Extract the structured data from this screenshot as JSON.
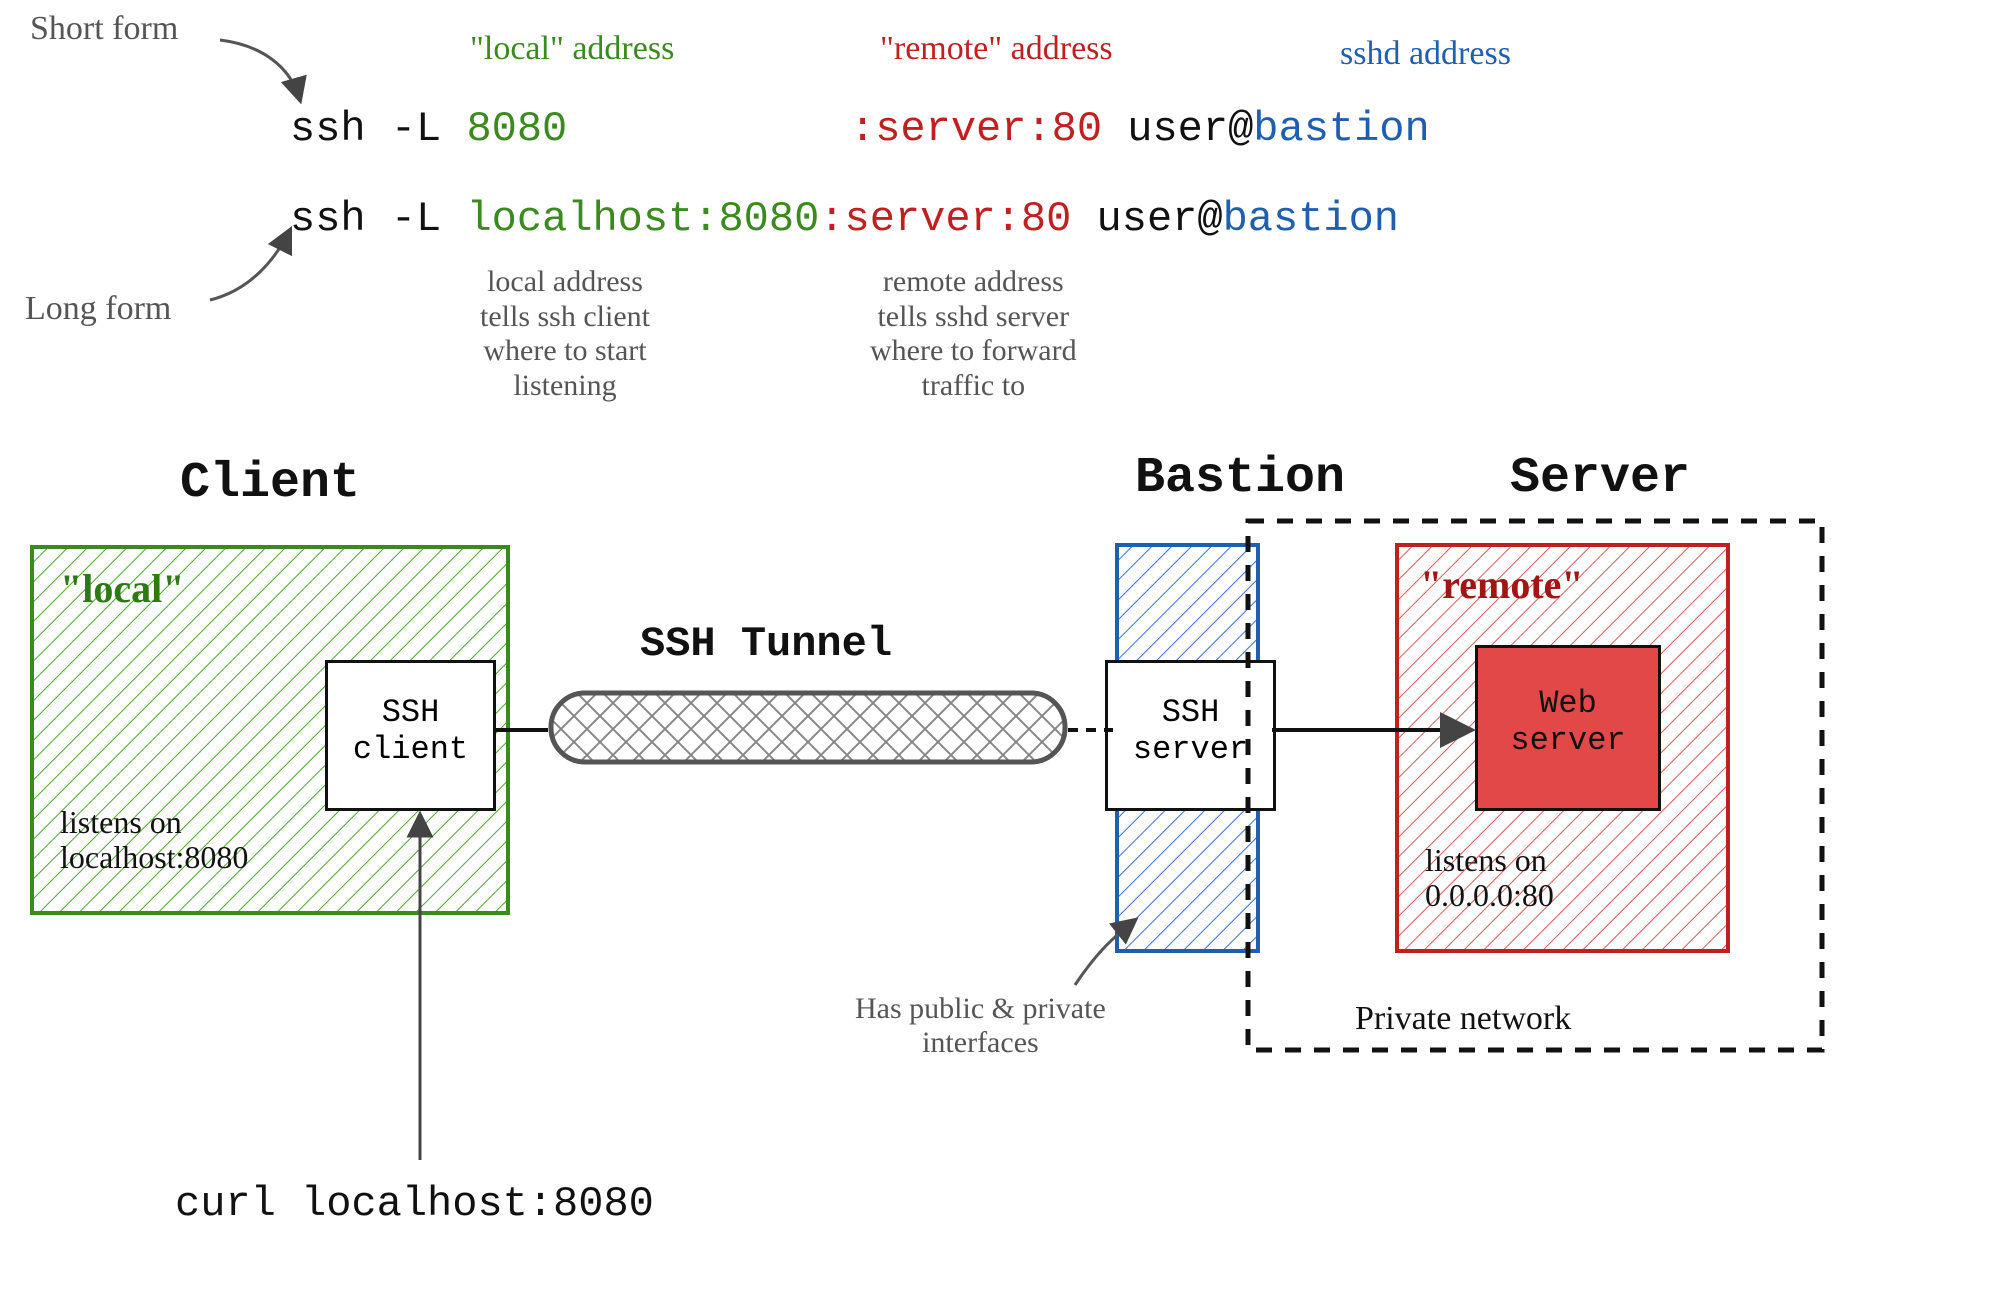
{
  "annotations": {
    "short_form": "Short form",
    "long_form": "Long form",
    "local_address": "\"local\" address",
    "remote_address": "\"remote\" address",
    "sshd_address": "sshd address",
    "local_explain": "local address\ntells ssh client\nwhere to start\nlistening",
    "remote_explain": "remote address\ntells sshd server\nwhere to forward\ntraffic to",
    "bastion_note": "Has public & private\ninterfaces",
    "private_network": "Private network",
    "curl_cmd": "curl localhost:8080"
  },
  "cmd": {
    "ssh_L": "ssh -L ",
    "short_port": "8080",
    "remote_part": ":server:80",
    "user_at": " user@",
    "bastion": "bastion",
    "long_local": "localhost:8080"
  },
  "diagram": {
    "client_title": "Client",
    "bastion_title": "Bastion",
    "server_title": "Server",
    "tunnel_label": "SSH Tunnel",
    "local_box_label": "\"local\"",
    "ssh_client_label": "SSH\nclient",
    "local_listen": "listens on\nlocalhost:8080",
    "ssh_server_label": "SSH\nserver",
    "remote_box_label": "\"remote\"",
    "web_server_label": "Web\nserver",
    "remote_listen": "listens on\n0.0.0.0:80"
  }
}
